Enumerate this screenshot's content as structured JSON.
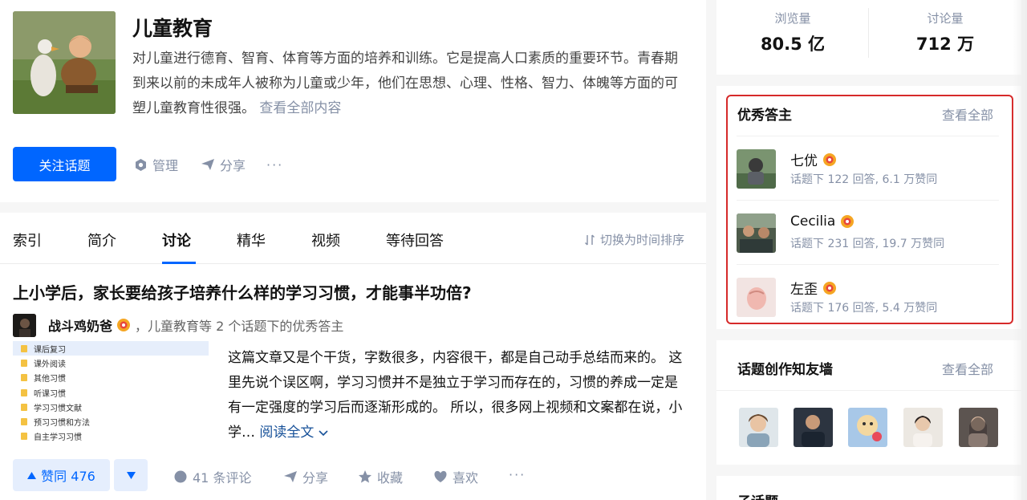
{
  "topic": {
    "title": "儿童教育",
    "description": "对儿童进行德育、智育、体育等方面的培养和训练。它是提高人口素质的重要环节。青春期到来以前的未成年人被称为儿童或少年，他们在思想、心理、性格、智力、体魄等方面的可塑儿童教育性很强。",
    "view_more": "查看全部内容",
    "follow_label": "关注话题",
    "manage_label": "管理",
    "share_label": "分享",
    "more_label": "···"
  },
  "tabs": {
    "items": [
      "索引",
      "简介",
      "讨论",
      "精华",
      "视频",
      "等待回答"
    ],
    "active": "讨论",
    "sort_label": "切换为时间排序"
  },
  "post": {
    "question": "上小学后，家长要给孩子培养什么样的学习习惯，才能事半功倍?",
    "author": "战斗鸡奶爸",
    "author_meta": "，儿童教育等 2 个话题下的优秀答主",
    "thumb_items": [
      "课后复习",
      "课外阅读",
      "其他习惯",
      "听课习惯",
      "学习习惯文献",
      "预习习惯和方法",
      "自主学习习惯"
    ],
    "excerpt": "这篇文章又是个干货，字数很多，内容很干，都是自己动手总结而来的。 这里先说个误区啊，学习习惯并不是独立于学习而存在的，习惯的养成一定是有一定强度的学习后而逐渐形成的。 所以，很多网上视频和文案都在说，小学…",
    "read_more": "阅读全文",
    "vote_label": "赞同 476",
    "comments": "41 条评论",
    "share": "分享",
    "collect": "收藏",
    "like": "喜欢",
    "more": "···"
  },
  "stats": {
    "views_label": "浏览量",
    "views_value": "80.5 亿",
    "discussions_label": "讨论量",
    "discussions_value": "712 万"
  },
  "answerers": {
    "title": "优秀答主",
    "more": "查看全部",
    "items": [
      {
        "name": "七优",
        "stats": "话题下 122 回答, 6.1 万赞同"
      },
      {
        "name": "Cecilia",
        "stats": "话题下 231 回答, 19.7 万赞同"
      },
      {
        "name": "左歪",
        "stats": "话题下 176 回答, 5.4 万赞同"
      }
    ]
  },
  "wall": {
    "title": "话题创作知友墙",
    "more": "查看全部"
  },
  "subtopics": {
    "title": "子话题"
  },
  "colors": {
    "accent": "#0066ff",
    "highlight": "#d62a2a",
    "muted": "#8590a6"
  }
}
